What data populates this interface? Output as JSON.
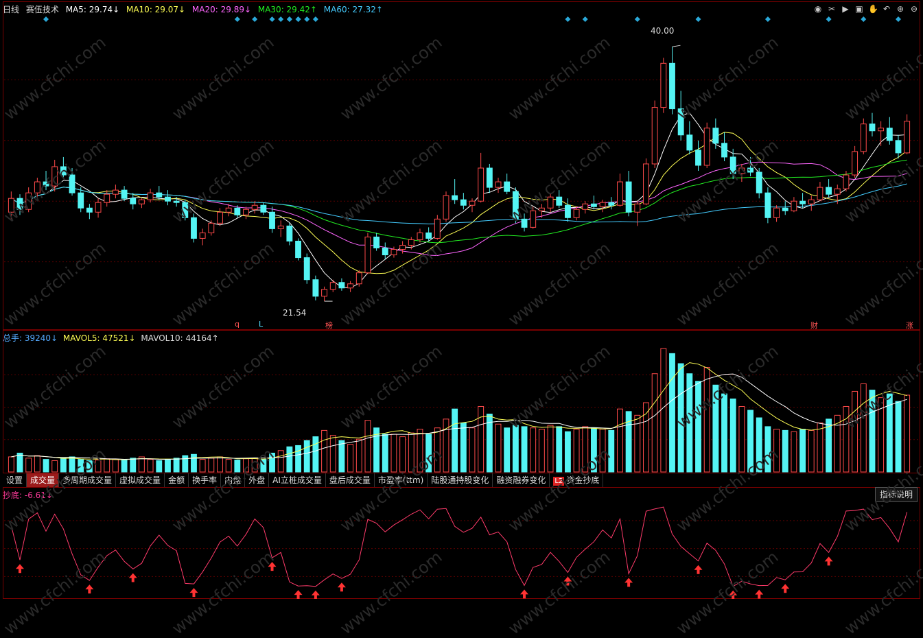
{
  "header": {
    "period": "日线",
    "stock_name": "赛伍技术",
    "ma5": "MA5: 29.74↓",
    "ma10": "MA10: 29.07↓",
    "ma20": "MA20: 29.89↓",
    "ma30": "MA30: 29.42↑",
    "ma60": "MA60: 27.32↑"
  },
  "colors": {
    "up": "#ff4a4a",
    "down": "#54f4f4",
    "ma5": "#ffffff",
    "ma10": "#ffff55",
    "ma20": "#ff66ff",
    "ma30": "#22ee22",
    "ma60": "#44ccff",
    "grid": "#5a0000",
    "signal": "#ff3b6b"
  },
  "toolbar_icons": [
    "eye-icon",
    "scissors-icon",
    "play-icon",
    "lock-icon",
    "hand-icon",
    "undo-icon",
    "zoom-in-icon",
    "zoom-out-icon"
  ],
  "price_labels": {
    "high": "40.00",
    "low": "21.54"
  },
  "event_marks": [
    {
      "text": "q"
    },
    {
      "text": "L"
    },
    {
      "text": "榜"
    },
    {
      "text": "财"
    },
    {
      "text": "涨"
    }
  ],
  "volume": {
    "total": "总手: 39240↓",
    "mavol5": "MAVOL5: 47521↓",
    "mavol10": "MAVOL10: 44164↑"
  },
  "tabs": [
    "设置",
    "成交量",
    "多周期成交量",
    "虚拟成交量",
    "金额",
    "换手率",
    "内盘",
    "外盘",
    "AI立桩成交量",
    "盘后成交量",
    "市盈率(ttm)",
    "陆股通持股变化",
    "融资融券变化",
    "资金抄底"
  ],
  "tab_l2_badge": "L2",
  "indicator": {
    "label": "抄底: -6.61↓",
    "explain_button": "指标说明"
  },
  "watermark": "www.cfchi.com",
  "chart_data": {
    "type": "candlestick",
    "price_range": [
      20,
      42
    ],
    "candles": [
      [
        28,
        29.5,
        27.5,
        29
      ],
      [
        29,
        29.3,
        27.8,
        28.2
      ],
      [
        28.2,
        29.8,
        28,
        29.4
      ],
      [
        29.4,
        30.5,
        29,
        30.2
      ],
      [
        30.2,
        31,
        29.6,
        29.9
      ],
      [
        29.9,
        31.8,
        29.5,
        31.3
      ],
      [
        31.3,
        32,
        30.5,
        30.7
      ],
      [
        30.7,
        31.2,
        29.2,
        29.4
      ],
      [
        29.4,
        29.8,
        28,
        28.3
      ],
      [
        28.3,
        28.6,
        27.5,
        28
      ],
      [
        28,
        29,
        27.6,
        28.7
      ],
      [
        28.7,
        29.6,
        28.4,
        29.3
      ],
      [
        29.3,
        30,
        29,
        29.6
      ],
      [
        29.6,
        29.9,
        28.8,
        29
      ],
      [
        29,
        29.4,
        28.2,
        28.6
      ],
      [
        28.6,
        29,
        28.3,
        28.9
      ],
      [
        28.9,
        29.7,
        28.7,
        29.4
      ],
      [
        29.4,
        29.9,
        28.9,
        29.1
      ],
      [
        29.1,
        29.6,
        28.5,
        28.8
      ],
      [
        28.8,
        29.1,
        28.4,
        28.7
      ],
      [
        28.7,
        28.9,
        27.4,
        27.6
      ],
      [
        27.6,
        27.9,
        25.8,
        26.1
      ],
      [
        26.1,
        26.8,
        25.6,
        26.5
      ],
      [
        26.5,
        27.4,
        26.3,
        27.2
      ],
      [
        27.2,
        28.3,
        27,
        28
      ],
      [
        28,
        28.6,
        27.7,
        28.3
      ],
      [
        28.3,
        28.5,
        27.6,
        27.8
      ],
      [
        27.8,
        28.4,
        27.5,
        28.2
      ],
      [
        28.2,
        28.8,
        27.9,
        28.5
      ],
      [
        28.5,
        28.7,
        27.8,
        28
      ],
      [
        28,
        28.4,
        26.5,
        26.8
      ],
      [
        26.8,
        27.4,
        26.2,
        27
      ],
      [
        27,
        27.2,
        25.6,
        25.9
      ],
      [
        25.9,
        26.1,
        24.5,
        24.7
      ],
      [
        24.7,
        25,
        22.8,
        23.1
      ],
      [
        23.1,
        23.4,
        21.6,
        21.9
      ],
      [
        21.9,
        22.6,
        21.54,
        22.4
      ],
      [
        22.4,
        23.1,
        22.2,
        22.9
      ],
      [
        22.9,
        23.2,
        22.3,
        22.5
      ],
      [
        22.5,
        23,
        22.2,
        22.8
      ],
      [
        22.8,
        23.8,
        22.6,
        23.6
      ],
      [
        23.6,
        26.5,
        23.5,
        26.2
      ],
      [
        26.2,
        26.5,
        25.2,
        25.4
      ],
      [
        25.4,
        25.8,
        24.6,
        24.9
      ],
      [
        24.9,
        25.5,
        24.7,
        25.3
      ],
      [
        25.3,
        25.9,
        25,
        25.6
      ],
      [
        25.6,
        26.2,
        25.3,
        26
      ],
      [
        26,
        26.8,
        25.8,
        26.5
      ],
      [
        26.5,
        26.9,
        25.9,
        26.1
      ],
      [
        26.1,
        27.8,
        26,
        27.5
      ],
      [
        27.5,
        29.5,
        27.3,
        29.2
      ],
      [
        29.2,
        30.4,
        28.6,
        28.9
      ],
      [
        28.9,
        29.4,
        28.2,
        28.5
      ],
      [
        28.5,
        29,
        28,
        28.8
      ],
      [
        28.8,
        32.3,
        28.7,
        31.2
      ],
      [
        31.2,
        31.5,
        29.4,
        29.8
      ],
      [
        29.8,
        30.5,
        29.4,
        30.2
      ],
      [
        30.2,
        30.8,
        29.3,
        29.5
      ],
      [
        29.5,
        29.8,
        27.2,
        27.5
      ],
      [
        27.5,
        27.9,
        26.6,
        26.9
      ],
      [
        26.9,
        28.4,
        26.8,
        28.1
      ],
      [
        28.1,
        28.6,
        27.6,
        28.3
      ],
      [
        28.3,
        29.4,
        28,
        29.1
      ],
      [
        29.1,
        29.6,
        28.3,
        28.5
      ],
      [
        28.5,
        29,
        27.3,
        27.6
      ],
      [
        27.6,
        28.4,
        27.4,
        28.2
      ],
      [
        28.2,
        28.8,
        27.9,
        28.6
      ],
      [
        28.6,
        29.2,
        28.2,
        28.4
      ],
      [
        28.4,
        28.9,
        28,
        28.7
      ],
      [
        28.7,
        29.1,
        28.2,
        28.5
      ],
      [
        28.5,
        30.8,
        28.4,
        30.2
      ],
      [
        30.2,
        31,
        27.7,
        28
      ],
      [
        28,
        28.8,
        27,
        28.6
      ],
      [
        28.6,
        31.9,
        28.5,
        31.5
      ],
      [
        31.5,
        36.1,
        31.2,
        35.6
      ],
      [
        35.6,
        39.2,
        35.2,
        38.8
      ],
      [
        38.8,
        40,
        35.1,
        35.5
      ],
      [
        35.5,
        36.8,
        33.2,
        33.6
      ],
      [
        33.6,
        34.6,
        32.2,
        32.5
      ],
      [
        32.5,
        33.2,
        31,
        31.4
      ],
      [
        31.4,
        34.5,
        31.2,
        34.1
      ],
      [
        34.1,
        34.8,
        32.6,
        33
      ],
      [
        33,
        33.8,
        31.7,
        32
      ],
      [
        32,
        32.6,
        30.4,
        30.8
      ],
      [
        30.8,
        31.5,
        30.2,
        31.2
      ],
      [
        31.2,
        32,
        30.6,
        30.9
      ],
      [
        30.9,
        31.2,
        29,
        29.4
      ],
      [
        29.4,
        29.8,
        27.2,
        27.6
      ],
      [
        27.6,
        28.5,
        27.3,
        28.3
      ],
      [
        28.3,
        28.8,
        27.8,
        28.1
      ],
      [
        28.1,
        29.1,
        28,
        28.8
      ],
      [
        28.8,
        29.4,
        28.3,
        28.6
      ],
      [
        28.6,
        29.2,
        28.1,
        28.9
      ],
      [
        28.9,
        30.2,
        28.8,
        29.8
      ],
      [
        29.8,
        30.4,
        29.1,
        29.3
      ],
      [
        29.3,
        30,
        28.6,
        29.7
      ],
      [
        29.7,
        31,
        29.5,
        30.7
      ],
      [
        30.7,
        32.8,
        30.5,
        32.4
      ],
      [
        32.4,
        34.8,
        32.2,
        34.4
      ],
      [
        34.4,
        35.2,
        33.5,
        33.9
      ],
      [
        33.9,
        34.6,
        32.8,
        34.1
      ],
      [
        34.1,
        34.9,
        32.9,
        33.2
      ],
      [
        33.2,
        33.6,
        31.9,
        32.3
      ],
      [
        32.3,
        35.1,
        32.2,
        34.6
      ]
    ],
    "volumes": [
      1200,
      1500,
      1100,
      1300,
      1000,
      900,
      1100,
      1200,
      1000,
      900,
      950,
      1050,
      1000,
      980,
      1100,
      1200,
      1000,
      900,
      950,
      1100,
      1300,
      1400,
      1000,
      1100,
      1200,
      1000,
      950,
      1050,
      1100,
      1000,
      1500,
      1700,
      2000,
      2100,
      2500,
      2800,
      3300,
      2900,
      2500,
      2200,
      2600,
      4100,
      3500,
      3000,
      3000,
      2800,
      3100,
      3400,
      3000,
      3500,
      4200,
      5000,
      3900,
      3500,
      5200,
      4600,
      3800,
      3500,
      3700,
      3600,
      3500,
      3400,
      3700,
      3600,
      3200,
      3400,
      3600,
      3500,
      3400,
      3300,
      5000,
      4800,
      4500,
      5500,
      7800,
      9800,
      9400,
      8600,
      7800,
      7200,
      8300,
      6900,
      6200,
      5800,
      5200,
      4900,
      4300,
      3600,
      3400,
      3300,
      3200,
      3400,
      3300,
      3900,
      4200,
      4500,
      5200,
      6400,
      7000,
      6500,
      5900,
      6200,
      5600,
      6100
    ]
  }
}
